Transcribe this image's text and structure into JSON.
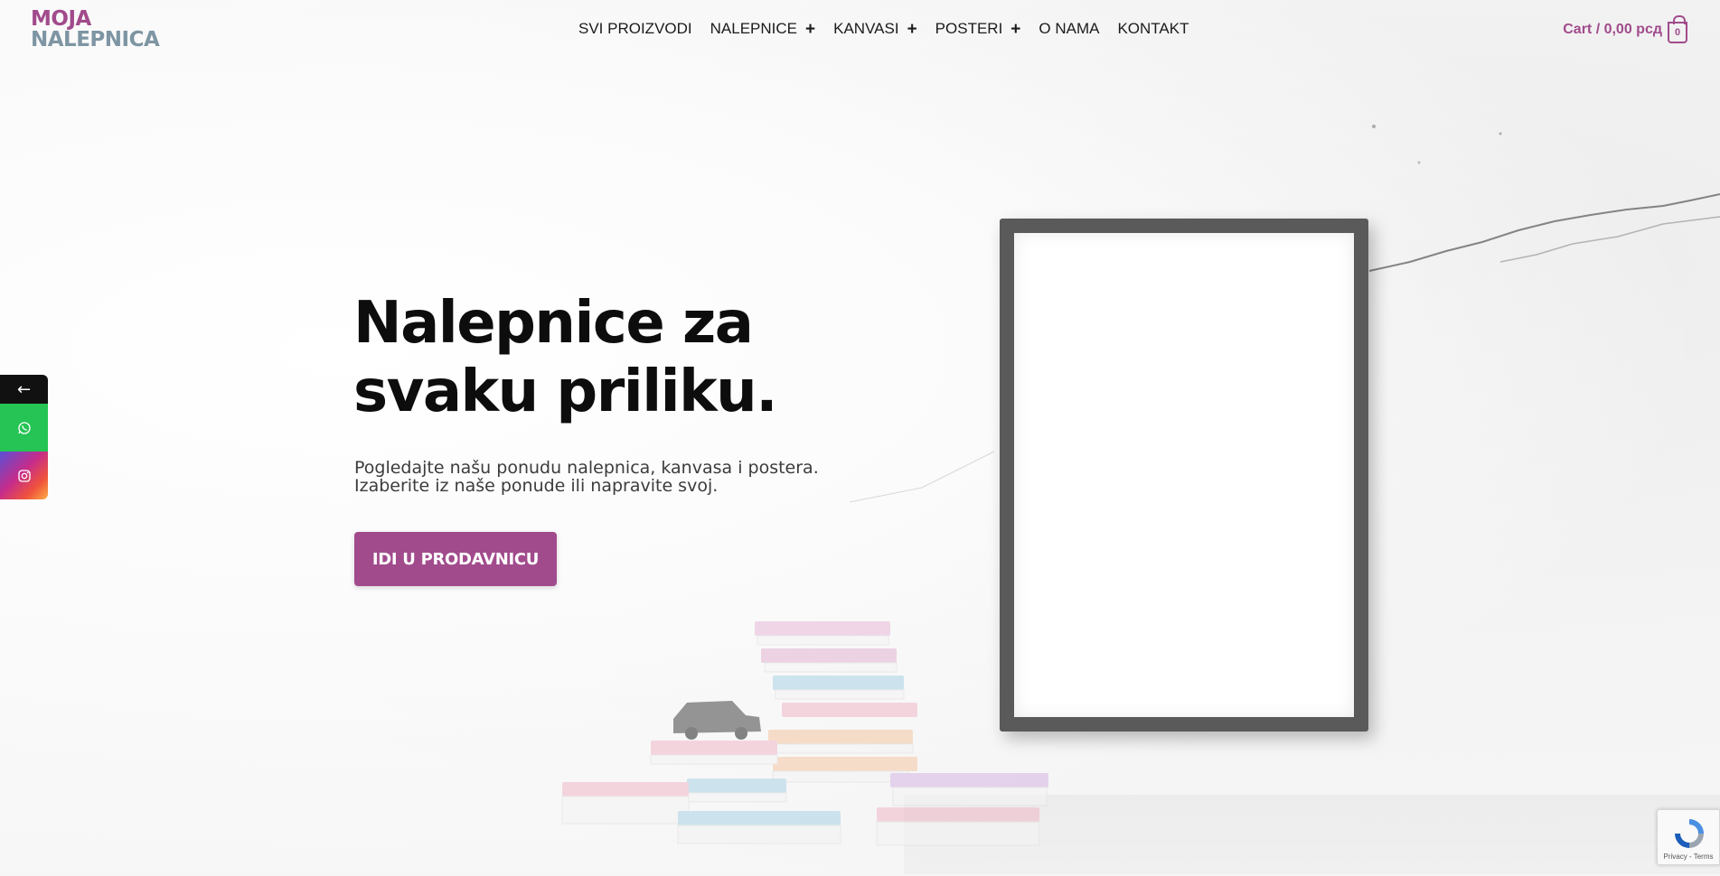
{
  "logo": {
    "line1": "MOJA",
    "line2": "NALEPNICA"
  },
  "nav": {
    "items": [
      {
        "label": "SVI PROIZVODI",
        "has_submenu": false
      },
      {
        "label": "NALEPNICE",
        "has_submenu": true
      },
      {
        "label": "KANVASI",
        "has_submenu": true
      },
      {
        "label": "POSTERI",
        "has_submenu": true
      },
      {
        "label": "O NAMA",
        "has_submenu": false
      },
      {
        "label": "KONTAKT",
        "has_submenu": false
      }
    ],
    "submenu_icon": "plus-icon"
  },
  "cart": {
    "label": "Cart / 0,00 рсд",
    "count": "0",
    "icon": "shopping-bag-icon"
  },
  "hero": {
    "title": "Nalepnice za svaku priliku.",
    "subtitle_line1": "Pogledajte našu ponudu nalepnica, kanvasa i postera.",
    "subtitle_line2": "Izaberite iz naše ponude ili napravite svoj.",
    "cta_label": "IDI U PRODAVNICU"
  },
  "social": {
    "collapse_arrow": "←",
    "items": [
      {
        "name": "whatsapp",
        "icon": "whatsapp-icon"
      },
      {
        "name": "instagram",
        "icon": "instagram-icon"
      }
    ]
  },
  "recaptcha": {
    "text": "Privacy - Terms"
  },
  "colors": {
    "brand": "#a14b8c",
    "logo_secondary": "#7e95a3",
    "whatsapp": "#25c455",
    "text": "#0d0d0d"
  }
}
